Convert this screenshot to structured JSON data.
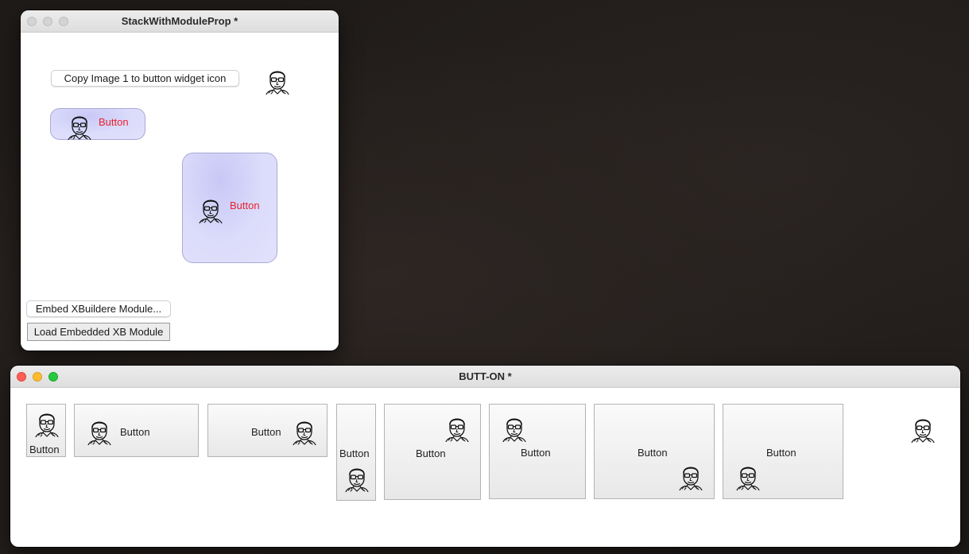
{
  "colors": {
    "desktop": "#1f1b19",
    "purple_fill": "#dcdcfb",
    "red_label": "#e8232f"
  },
  "window1": {
    "title": "StackWithModuleProp *",
    "copy_button": "Copy Image 1 to button widget icon",
    "image1_icon": "portrait-face-icon",
    "purple_button_small": "Button",
    "purple_button_large": "Button",
    "embed_button": "Embed XBuildere Module...",
    "load_button": "Load Embedded XB Module"
  },
  "window2": {
    "title": "BUTT-ON *",
    "buttons": [
      {
        "label": "Button",
        "icon_position": "top"
      },
      {
        "label": "Button",
        "icon_position": "left"
      },
      {
        "label": "Button",
        "icon_position": "right"
      },
      {
        "label": "Button",
        "icon_position": "bottom"
      },
      {
        "label": "Button",
        "icon_position": "top-right"
      },
      {
        "label": "Button",
        "icon_position": "top-left"
      },
      {
        "label": "Button",
        "icon_position": "bottom-right"
      },
      {
        "label": "Button",
        "icon_position": "bottom-left"
      }
    ],
    "standalone_icon": "portrait-face-icon"
  }
}
